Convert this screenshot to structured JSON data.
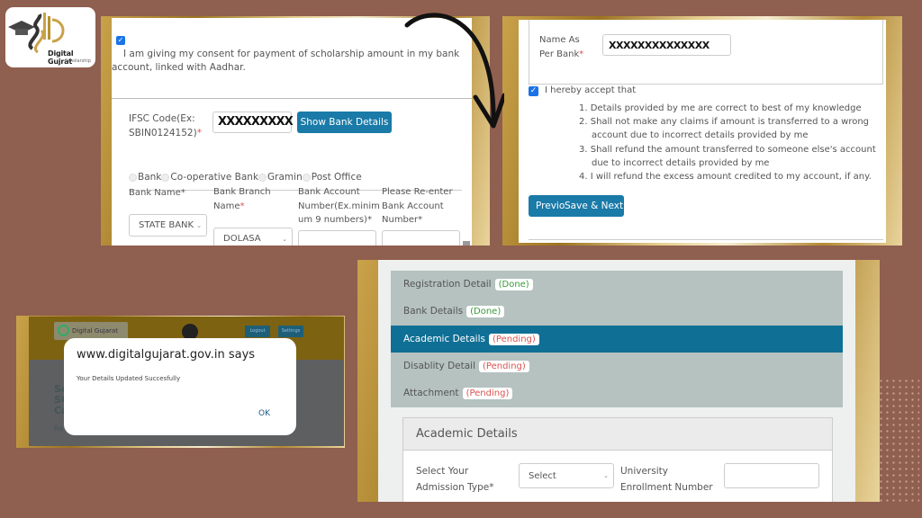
{
  "logo": {
    "line1": "Digital Gujrat",
    "line2": "Scholarship"
  },
  "bank_form": {
    "consent_checked": true,
    "consent_text": "I am giving my consent for payment of scholarship amount in my bank account, linked with Aadhar.",
    "ifsc_label_line1": "IFSC Code(Ex:",
    "ifsc_label_line2": "SBIN0124152)",
    "required_mark": "*",
    "ifsc_value": "XXXXXXXXX",
    "show_bank_details_label": "Show Bank Details",
    "bank_types": [
      "Bank",
      "Co-operative Bank",
      "Gramin",
      "Post Office"
    ],
    "bank_name_label": "Bank Name",
    "bank_name_value": "STATE BANK",
    "branch_label_line1": "Bank Branch",
    "branch_label_line2": "Name",
    "branch_value": "DOLASA",
    "account_label_line1": "Bank Account",
    "account_label_line2": "Number(Ex.minim",
    "account_label_line3": "um 9 numbers)",
    "account_value": "",
    "reenter_label_line1": "Please Re-enter",
    "reenter_label_line2": "Bank Account",
    "reenter_label_line3": "Number",
    "reenter_value": ""
  },
  "declaration": {
    "name_label_line1": "Name As",
    "name_label_line2": "Per Bank",
    "required_mark": "*",
    "name_value": "XXXXXXXXXXXXXX",
    "accept_checked": true,
    "accept_text": "I hereby accept that",
    "items": [
      "1. Details provided by me are correct to best of my knowledge",
      "2. Shall not make any claims if amount is transferred to a wrong account due to incorrect details provided by me",
      "3. Shall refund the amount transferred to someone else's account due to incorrect details provided by me",
      "4. I will refund the excess amount credited to my account, if any."
    ],
    "previous_label": "Previous",
    "save_next_label": "Save & Next"
  },
  "popup": {
    "site_logo_text": "Digital Gujarat",
    "logout_label": "Logout",
    "settings_label": "Settings",
    "dialog_title": "www.digitalgujarat.gov.in says",
    "dialog_message": "Your Details Updated Succesfully",
    "ok_label": "OK"
  },
  "progress": {
    "steps": [
      {
        "label": "Registration Detail",
        "status": "(Done)",
        "state": "done"
      },
      {
        "label": "Bank Details",
        "status": "(Done)",
        "state": "done"
      },
      {
        "label": "Academic Details",
        "status": "(Pending)",
        "state": "pending",
        "active": true
      },
      {
        "label": "Disablity Detail",
        "status": "(Pending)",
        "state": "pending"
      },
      {
        "label": "Attachment",
        "status": "(Pending)",
        "state": "pending"
      }
    ],
    "section_title": "Academic Details",
    "admission_label_line1": "Select Your",
    "admission_label_line2": "Admission Type",
    "required_mark": "*",
    "admission_value": "Select",
    "enrollment_label_line1": "University",
    "enrollment_label_line2": "Enrollment Number",
    "enrollment_value": ""
  },
  "colors": {
    "primary_button": "#1a7aa8",
    "active_step": "#106f95",
    "done": "#3a9a3a",
    "pending": "#d9534f",
    "background": "#8f5f4f"
  }
}
